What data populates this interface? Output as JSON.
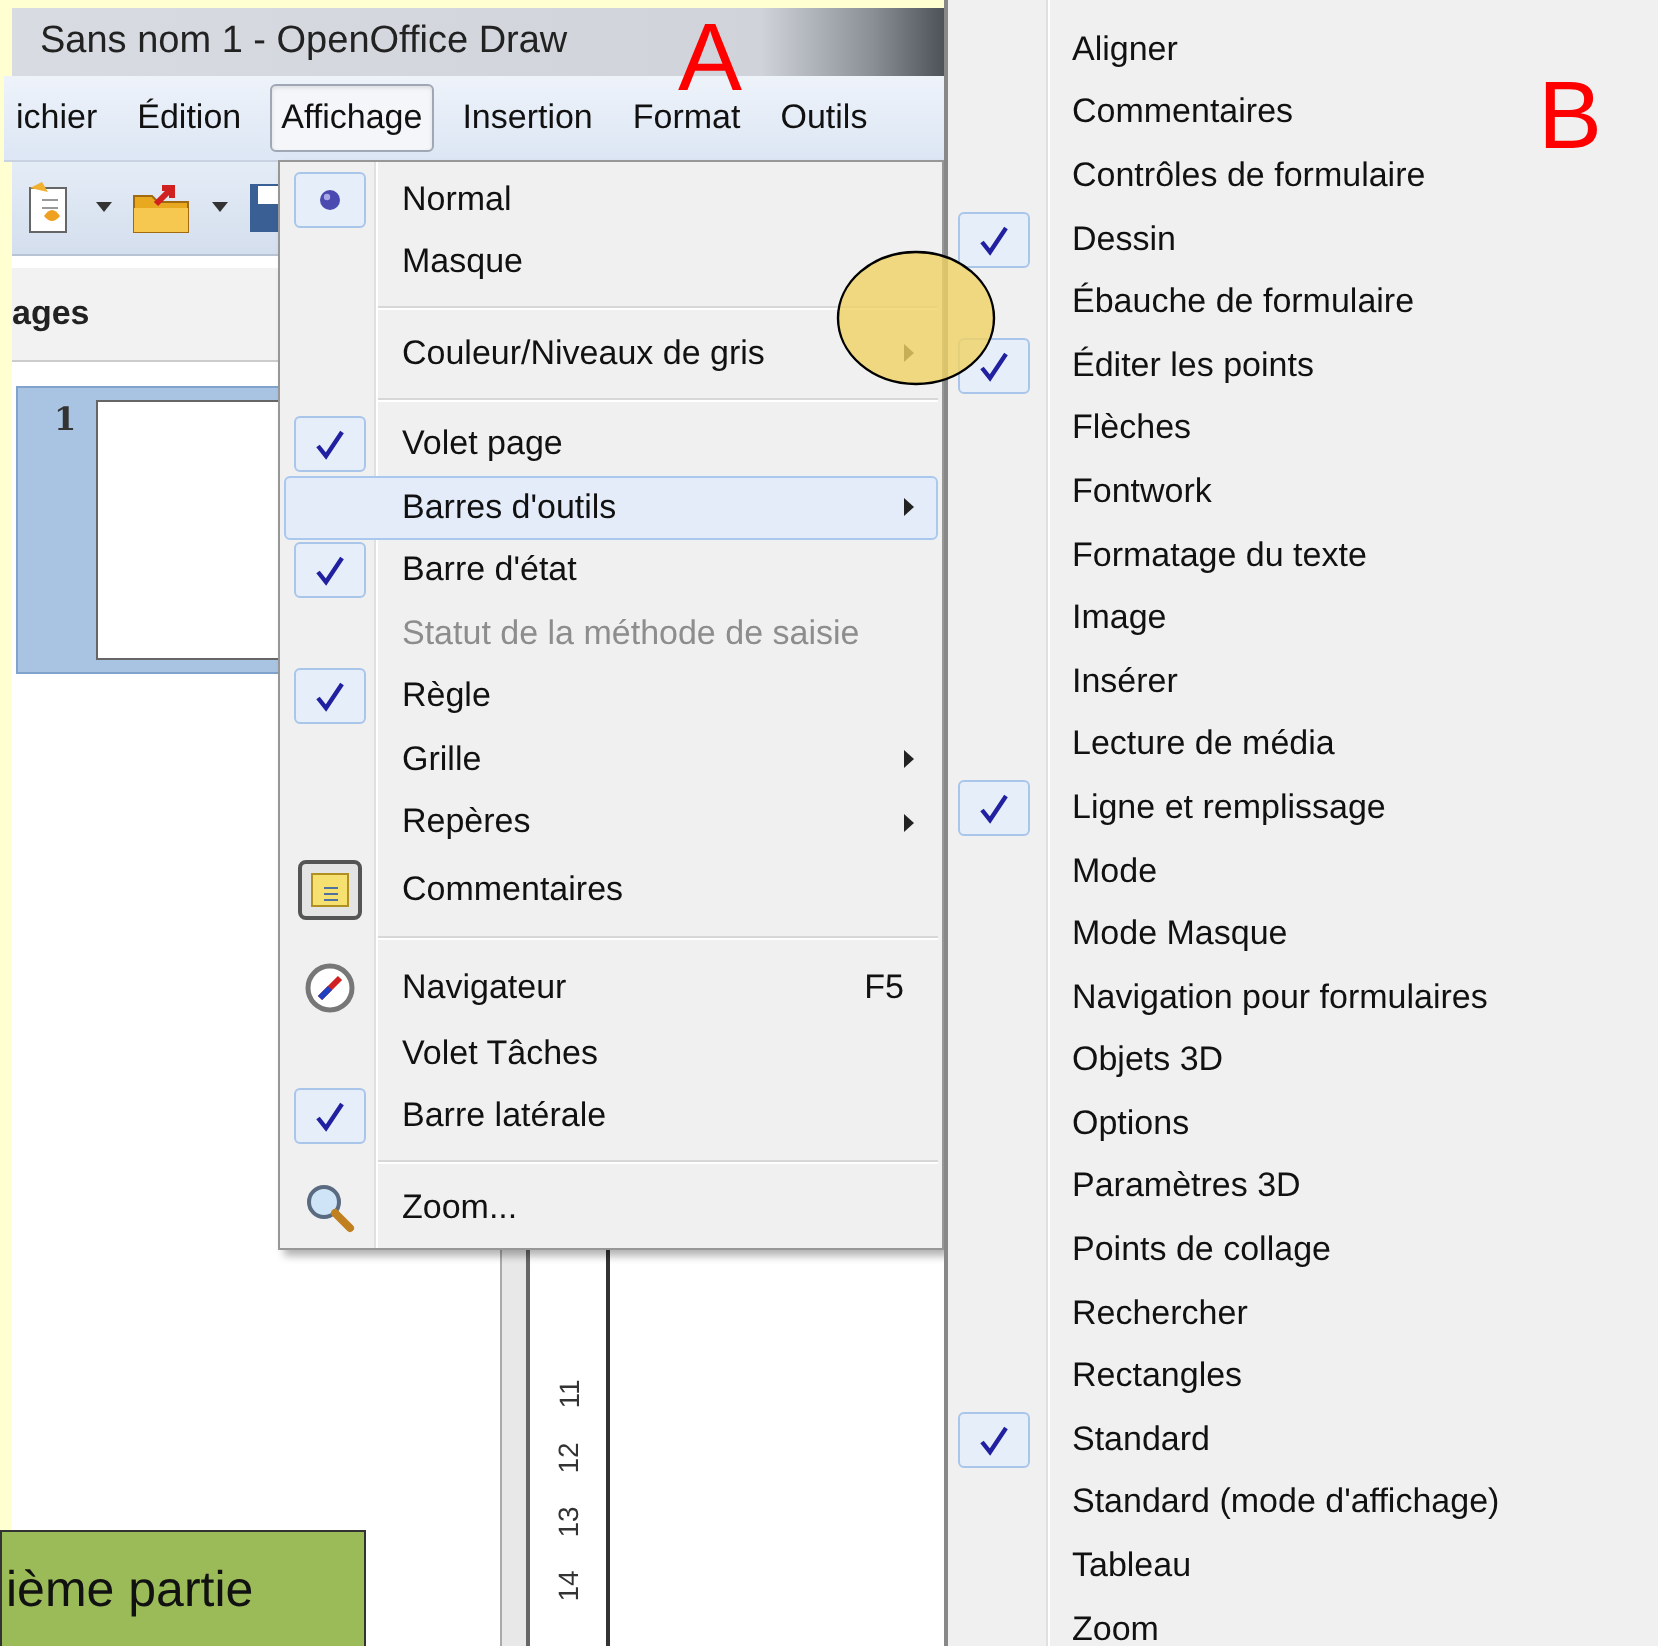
{
  "window": {
    "title": "Sans nom 1 - OpenOffice Draw"
  },
  "menu_bar": [
    {
      "label": "ichier",
      "selected": false
    },
    {
      "label": "Édition",
      "selected": false
    },
    {
      "label": "Affichage",
      "selected": true
    },
    {
      "label": "Insertion",
      "selected": false
    },
    {
      "label": "Format",
      "selected": false
    },
    {
      "label": "Outils",
      "selected": false
    }
  ],
  "side_panel": {
    "title": "ages",
    "thumbnails": [
      {
        "number": "1",
        "selected": true
      }
    ]
  },
  "ruler": {
    "labels": [
      "11",
      "12",
      "13",
      "14"
    ]
  },
  "view_menu": {
    "items": [
      {
        "kind": "radio",
        "label": "Normal",
        "checked": true,
        "selected": false,
        "disabled": false,
        "submenu": false
      },
      {
        "kind": "radio",
        "label": "Masque",
        "checked": false,
        "selected": false,
        "disabled": false,
        "submenu": false
      },
      {
        "kind": "separator"
      },
      {
        "kind": "check",
        "label": "Couleur/Niveaux de gris",
        "checked": false,
        "selected": false,
        "disabled": false,
        "submenu": true
      },
      {
        "kind": "separator"
      },
      {
        "kind": "check",
        "label": "Volet page",
        "checked": true,
        "selected": false,
        "disabled": false,
        "submenu": false
      },
      {
        "kind": "check",
        "label": "Barres d'outils",
        "checked": false,
        "selected": true,
        "disabled": false,
        "submenu": true
      },
      {
        "kind": "check",
        "label": "Barre d'état",
        "checked": true,
        "selected": false,
        "disabled": false,
        "submenu": false
      },
      {
        "kind": "check",
        "label": "Statut de la méthode de saisie",
        "checked": false,
        "selected": false,
        "disabled": true,
        "submenu": false
      },
      {
        "kind": "check",
        "label": "Règle",
        "checked": true,
        "selected": false,
        "disabled": false,
        "submenu": false
      },
      {
        "kind": "check",
        "label": "Grille",
        "checked": false,
        "selected": false,
        "disabled": false,
        "submenu": true
      },
      {
        "kind": "check",
        "label": "Repères",
        "checked": false,
        "selected": false,
        "disabled": false,
        "submenu": true
      },
      {
        "kind": "note",
        "label": "Commentaires",
        "checked": true,
        "selected": false,
        "disabled": false,
        "submenu": false
      },
      {
        "kind": "separator"
      },
      {
        "kind": "compass",
        "label": "Navigateur",
        "shortcut": "F5",
        "checked": false,
        "selected": false,
        "disabled": false,
        "submenu": false
      },
      {
        "kind": "check",
        "label": "Volet Tâches",
        "checked": false,
        "selected": false,
        "disabled": false,
        "submenu": false
      },
      {
        "kind": "check",
        "label": "Barre latérale",
        "checked": true,
        "selected": false,
        "disabled": false,
        "submenu": false
      },
      {
        "kind": "separator"
      },
      {
        "kind": "magnifier",
        "label": "Zoom...",
        "checked": false,
        "selected": false,
        "disabled": false,
        "submenu": false
      }
    ]
  },
  "toolbars_submenu": {
    "items": [
      {
        "label": "Aligner",
        "checked": false
      },
      {
        "label": "Commentaires",
        "checked": false
      },
      {
        "label": "Contrôles de formulaire",
        "checked": false
      },
      {
        "label": "Dessin",
        "checked": true
      },
      {
        "label": "Ébauche de formulaire",
        "checked": false
      },
      {
        "label": "Éditer les points",
        "checked": true
      },
      {
        "label": "Flèches",
        "checked": false
      },
      {
        "label": "Fontwork",
        "checked": false
      },
      {
        "label": "Formatage du texte",
        "checked": false
      },
      {
        "label": "Image",
        "checked": false
      },
      {
        "label": "Insérer",
        "checked": false
      },
      {
        "label": "Lecture de média",
        "checked": false
      },
      {
        "label": "Ligne et remplissage",
        "checked": true
      },
      {
        "label": "Mode",
        "checked": false
      },
      {
        "label": "Mode Masque",
        "checked": false
      },
      {
        "label": "Navigation pour formulaires",
        "checked": false
      },
      {
        "label": "Objets 3D",
        "checked": false
      },
      {
        "label": "Options",
        "checked": false
      },
      {
        "label": "Paramètres 3D",
        "checked": false
      },
      {
        "label": "Points de collage",
        "checked": false
      },
      {
        "label": "Rechercher",
        "checked": false
      },
      {
        "label": "Rectangles",
        "checked": false
      },
      {
        "label": "Standard",
        "checked": true
      },
      {
        "label": "Standard (mode d'affichage)",
        "checked": false
      },
      {
        "label": "Tableau",
        "checked": false
      },
      {
        "label": "Zoom",
        "checked": false
      }
    ]
  },
  "callouts": [
    {
      "text": "A"
    },
    {
      "text": "B"
    }
  ],
  "caption": "ième partie"
}
